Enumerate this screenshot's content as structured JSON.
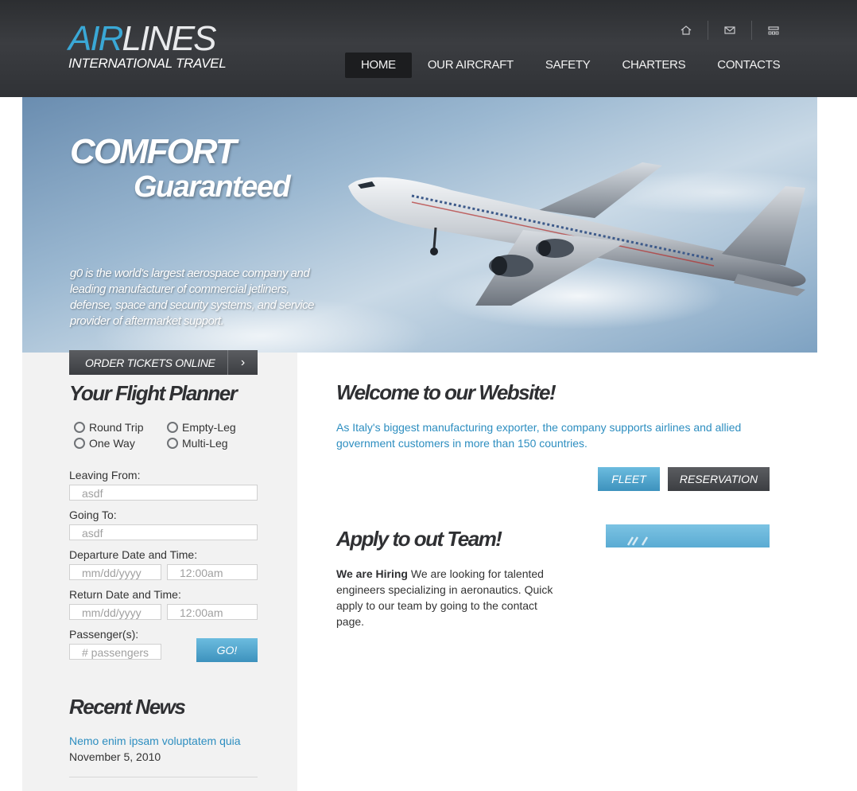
{
  "header": {
    "logo_air": "AIR",
    "logo_lines": "LINES",
    "logo_sub": "INTERNATIONAL TRAVEL",
    "top_icons": [
      "home-icon",
      "mail-icon",
      "sitemap-icon"
    ],
    "nav": [
      {
        "label": "HOME",
        "active": true
      },
      {
        "label": "OUR AIRCRAFT",
        "active": false
      },
      {
        "label": "SAFETY",
        "active": false
      },
      {
        "label": "CHARTERS",
        "active": false
      },
      {
        "label": "CONTACTS",
        "active": false
      }
    ]
  },
  "hero": {
    "title1": "COMFORT",
    "title2": "Guaranteed",
    "text": "g0 is the world's largest aerospace company and leading manufacturer of commercial jetliners, defense, space and security systems, and service provider of aftermarket support."
  },
  "sidebar": {
    "order_label": "ORDER TICKETS ONLINE",
    "planner_title": "Your Flight Planner",
    "trip_types": [
      "Round Trip",
      "Empty-Leg",
      "One Way",
      "Multi-Leg"
    ],
    "leaving_label": "Leaving From:",
    "leaving_value": "asdf",
    "going_label": "Going To:",
    "going_value": "asdf",
    "departure_label": "Departure Date and Time:",
    "departure_date_placeholder": "mm/dd/yyyy",
    "departure_time_placeholder": "12:00am",
    "return_label": "Return Date and Time:",
    "return_date_placeholder": "mm/dd/yyyy",
    "return_time_placeholder": "12:00am",
    "passengers_label": "Passenger(s):",
    "passengers_placeholder": "# passengers",
    "go_label": "GO!",
    "news_title": "Recent News",
    "news_item": "Nemo enim ipsam voluptatem quia",
    "news_date": "November 5, 2010"
  },
  "main": {
    "welcome_title": "Welcome to our Website!",
    "welcome_text": "As Italy's biggest manufacturing exporter, the company supports airlines and allied government customers in more than 150 countries.",
    "fleet_label": "FLEET",
    "reservation_label": "RESERVATION",
    "apply_title": "Apply to out Team!",
    "apply_bold": "We are Hiring",
    "apply_text": " We are looking for talented engineers specializing in aeronautics. Quick apply to our team by going to the contact page."
  },
  "colors": {
    "accent_blue": "#2d8ec0",
    "header_dark": "#303236",
    "logo_blue": "#3aa8d6"
  }
}
